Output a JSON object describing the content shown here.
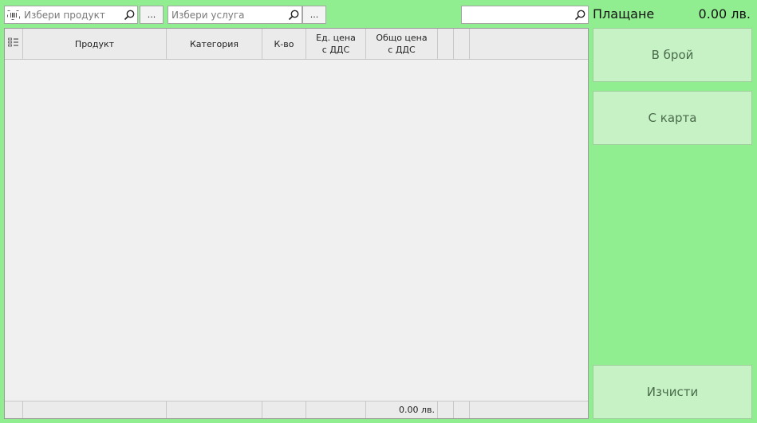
{
  "toolbar": {
    "product_placeholder": "Избери продукт",
    "service_placeholder": "Избери услуга",
    "search_placeholder": "",
    "dots_label": "..."
  },
  "payment": {
    "title": "Плащане",
    "total": "0.00 лв."
  },
  "grid": {
    "columns": [
      {
        "label": ""
      },
      {
        "label": "Продукт"
      },
      {
        "label": "Категория"
      },
      {
        "label": "К-во"
      },
      {
        "label": "Ед. цена\nс ДДС"
      },
      {
        "label": "Общо цена\nс ДДС"
      },
      {
        "label": ""
      },
      {
        "label": ""
      }
    ],
    "rows": [],
    "footer_total": "0.00 лв."
  },
  "buttons": {
    "cash": "В брой",
    "card": "С карта",
    "clear": "Изчисти"
  },
  "colors": {
    "background": "#90ee90",
    "button_fill": "#c6f2c6",
    "button_text": "#4a6b4a"
  }
}
